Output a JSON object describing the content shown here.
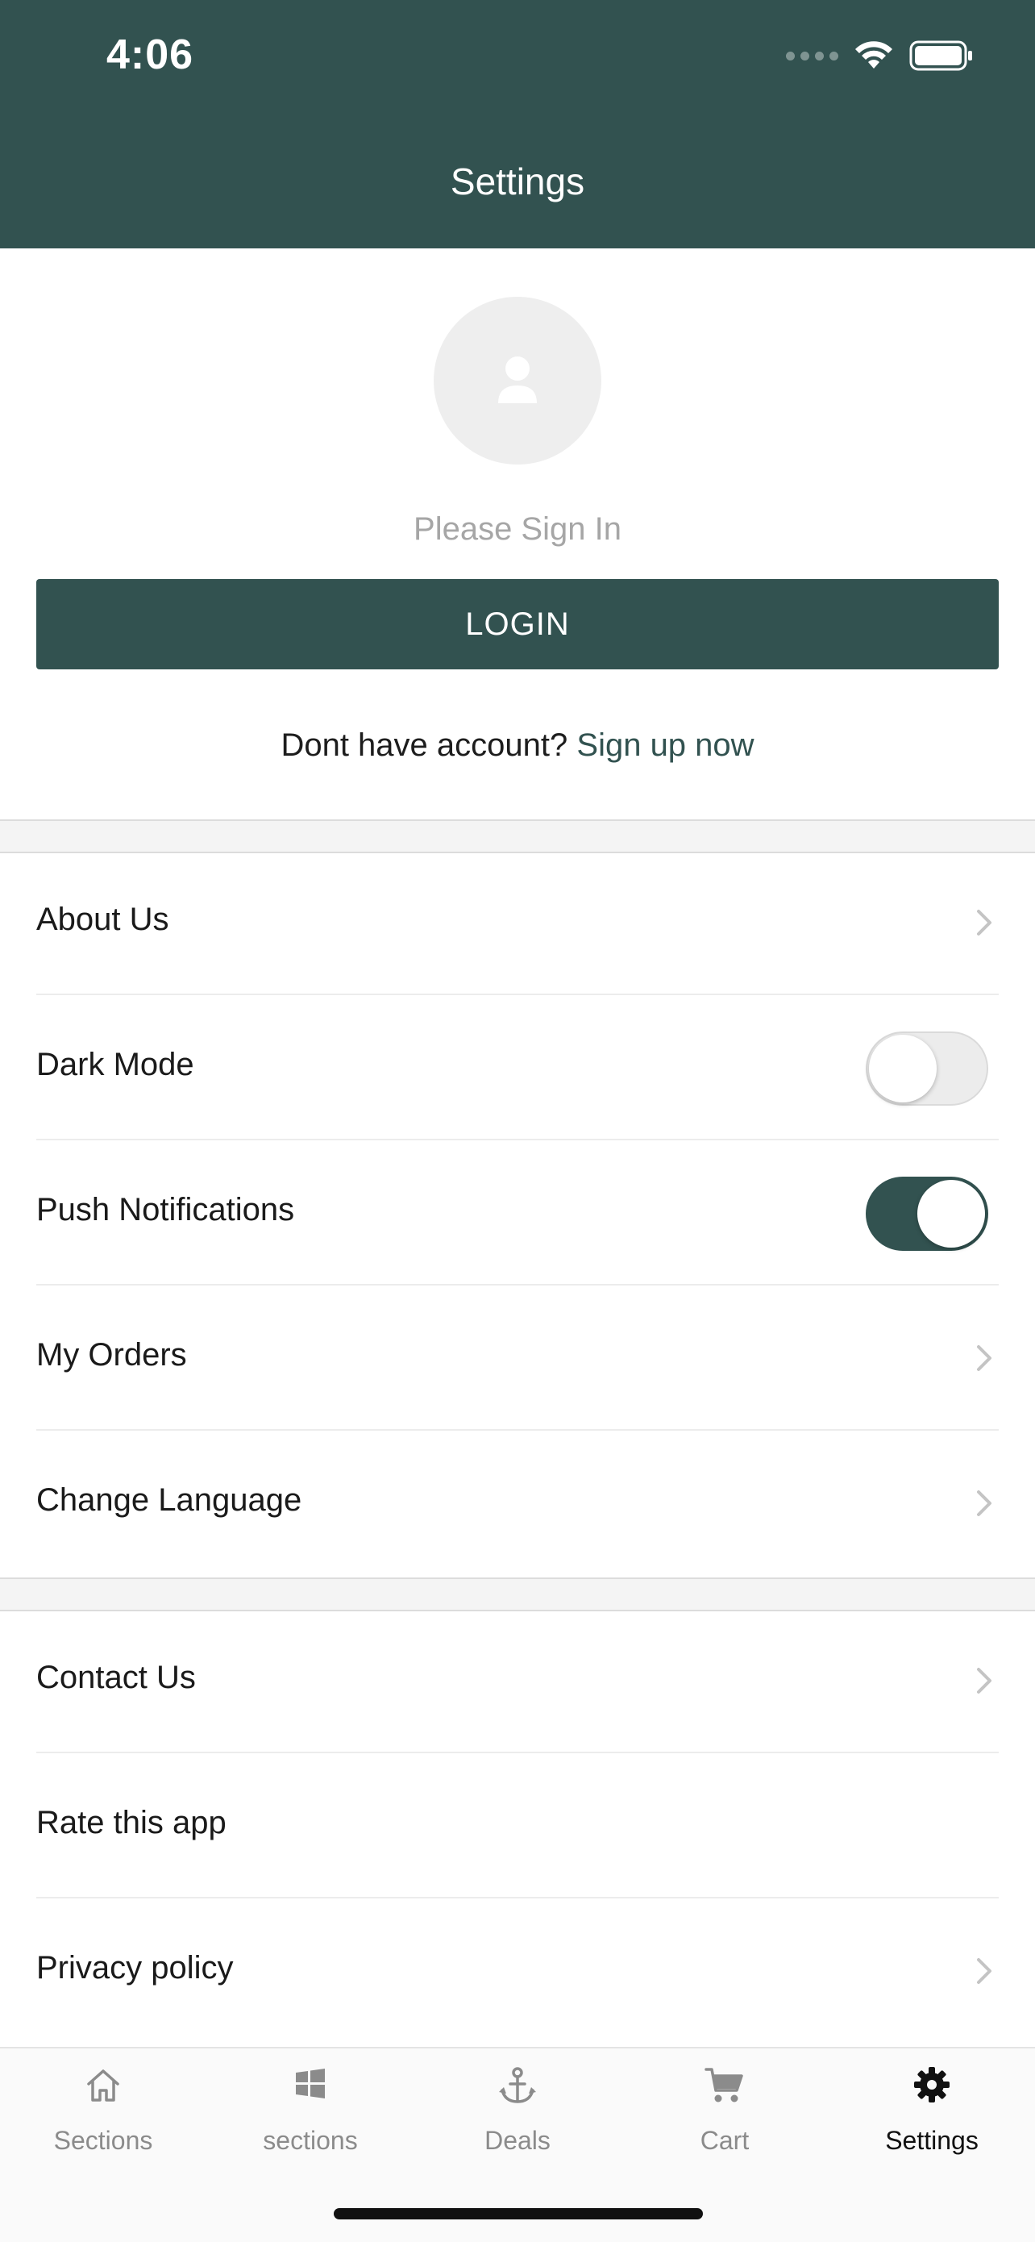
{
  "status_bar": {
    "time": "4:06"
  },
  "header": {
    "title": "Settings"
  },
  "profile": {
    "prompt": "Please Sign In",
    "login_label": "LOGIN",
    "signup_text": "Dont have account?",
    "signup_link": "Sign up now"
  },
  "section1": {
    "about": "About Us",
    "dark_mode": "Dark Mode",
    "dark_mode_on": false,
    "push": "Push Notifications",
    "push_on": true,
    "orders": "My Orders",
    "language": "Change Language"
  },
  "section2": {
    "contact": "Contact Us",
    "rate": "Rate this app",
    "privacy": "Privacy policy"
  },
  "tabbar": {
    "tabs": [
      {
        "label": "Sections",
        "icon": "home-icon"
      },
      {
        "label": "sections",
        "icon": "windows-icon"
      },
      {
        "label": "Deals",
        "icon": "anchor-icon"
      },
      {
        "label": "Cart",
        "icon": "cart-icon"
      },
      {
        "label": "Settings",
        "icon": "gear-icon",
        "active": true
      }
    ]
  },
  "colors": {
    "brand": "#325250",
    "muted": "#a6a6a6"
  }
}
